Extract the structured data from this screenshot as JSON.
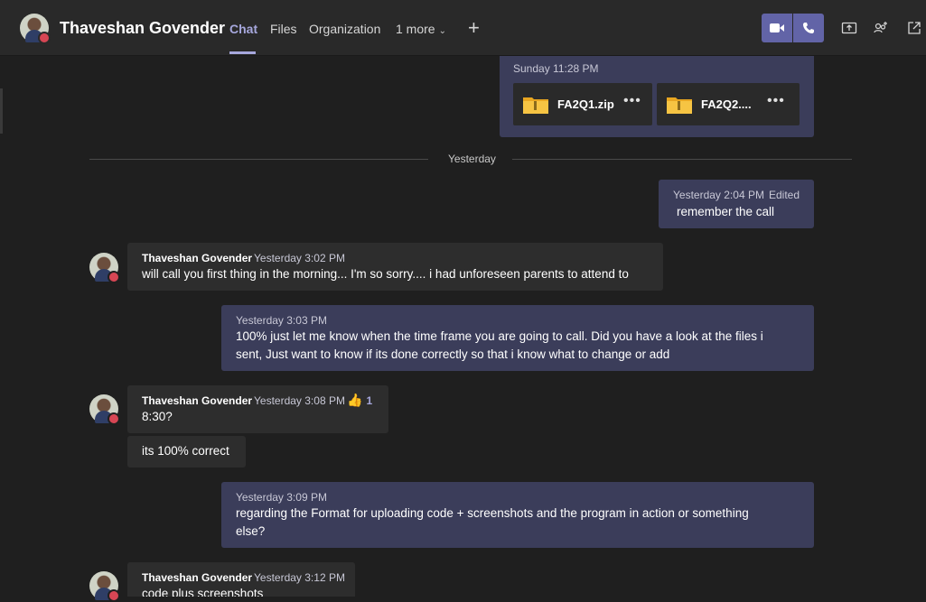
{
  "header": {
    "name": "Thaveshan Govender",
    "tabs": [
      {
        "label": "Chat",
        "active": true
      },
      {
        "label": "Files"
      },
      {
        "label": "Organization"
      },
      {
        "label": "1 more"
      }
    ],
    "icons": [
      "add-tab-icon",
      "video-call-icon",
      "audio-call-icon",
      "share-screen-icon",
      "add-people-icon",
      "pop-out-icon"
    ],
    "accent": "#6264a7",
    "presence_color": "#d74654"
  },
  "files_message": {
    "timestamp": "Sunday 11:28 PM",
    "files": [
      {
        "name": "FA2Q1.zip",
        "icon": "zip-folder-icon"
      },
      {
        "name": "FA2Q2....",
        "icon": "zip-folder-icon"
      }
    ]
  },
  "day_divider": "Yesterday",
  "messages": [
    {
      "direction": "out",
      "timestamp": "Yesterday 2:04 PM",
      "edited": "Edited",
      "text": "remember the call"
    },
    {
      "direction": "in",
      "sender": "Thaveshan Govender",
      "timestamp": "Yesterday 3:02 PM",
      "text": "will call you first thing in the morning... I'm so sorry.... i had unforeseen parents to attend to"
    },
    {
      "direction": "out",
      "timestamp": "Yesterday 3:03 PM",
      "text_line1": "100% just let me know when the time frame you are going to call. Did you have a look at the files i",
      "text_line2": "sent, Just want to know if its done correctly so that i know what to change or add"
    },
    {
      "direction": "in",
      "sender": "Thaveshan Govender",
      "timestamp": "Yesterday 3:08 PM",
      "reaction": {
        "icon": "thumbs-up-icon",
        "count": "1"
      },
      "text": "8:30?"
    },
    {
      "direction": "in",
      "text": "its 100% correct"
    },
    {
      "direction": "out",
      "timestamp": "Yesterday 3:09 PM",
      "text_line1": "regarding the Format for uploading code + screenshots and the program in action or something",
      "text_line2": "else?"
    },
    {
      "direction": "in",
      "sender": "Thaveshan Govender",
      "timestamp": "Yesterday 3:12 PM",
      "text": "code plus screenshots"
    }
  ]
}
